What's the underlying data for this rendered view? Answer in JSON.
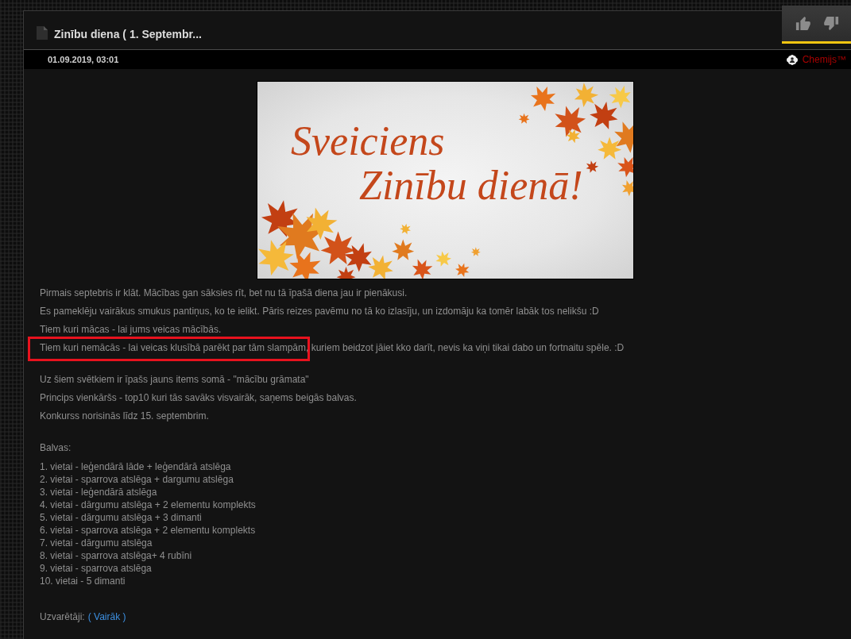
{
  "post": {
    "title": "Zinību diena ( 1. Septembr...",
    "date": "01.09.2019, 03:01",
    "author": "Chemijs™"
  },
  "rating": {
    "actions": [
      {
        "kind": "like"
      },
      {
        "kind": "dislike"
      }
    ]
  },
  "banner": {
    "lines": [
      "Sveiciens",
      "Zinību dienā!"
    ]
  },
  "sections": [
    {
      "paragraphs": [
        {
          "segments": [
            {
              "text": "Pirmais septebris ir klāt. Mācības gan sāksies rīt, bet nu tā īpašā diena jau ir pienākusi.",
              "highlighted": false
            }
          ]
        },
        {
          "segments": [
            {
              "text": "Es pameklēju vairākus smukus pantiņus, ko te ielikt. Pāris reizes pavēmu no tā ko izlasīju, un izdomāju ka tomēr labāk tos nelikšu :D",
              "highlighted": false
            }
          ]
        },
        {
          "segments": [
            {
              "text": "Tiem kuri mācas - lai jums veicas mācībās.",
              "highlighted": false
            }
          ]
        },
        {
          "segments": [
            {
              "text": "Tiem kuri nemācās - lai veicas klusībā parēkt par tām slampām",
              "highlighted": true
            },
            {
              "text": ", kuriem beidzot jāiet kko darīt, nevis ka viņi tikai dabo un fortnaitu spēle. :D",
              "highlighted": false
            }
          ]
        }
      ]
    },
    {
      "paragraphs": [
        {
          "segments": [
            {
              "text": "Uz šiem svētkiem ir īpašs jauns items somā - \"mācību grāmata\"",
              "highlighted": false
            }
          ]
        },
        {
          "segments": [
            {
              "text": "Princips vienkāršs - top10 kuri tās savāks visvairāk, saņems beigās balvas.",
              "highlighted": false
            }
          ]
        },
        {
          "segments": [
            {
              "text": "Konkurss norisinās līdz 15. septembrim.",
              "highlighted": false
            }
          ]
        }
      ]
    }
  ],
  "prizes": {
    "heading": "Balvas:",
    "items": [
      "1. vietai - leģendārā lāde + leģendārā atslēga",
      "2. vietai - sparrova atslēga + dargumu atslēga",
      "3. vietai - leģendārā atslēga",
      "4. vietai - dārgumu atslēga + 2 elementu komplekts",
      "5. vietai - dārgumu atslēga + 3 dimanti",
      "6. vietai - sparrova atslēga + 2 elementu komplekts",
      "7. vietai - dārgumu atslēga",
      "8. vietai - sparrova atslēga+ 4 rubīni",
      "9. vietai - sparrova atslēga",
      "10. vietai - 5 dimanti"
    ]
  },
  "winners": {
    "label": "Uzvarētāji:",
    "link": "( Vairāk )"
  }
}
